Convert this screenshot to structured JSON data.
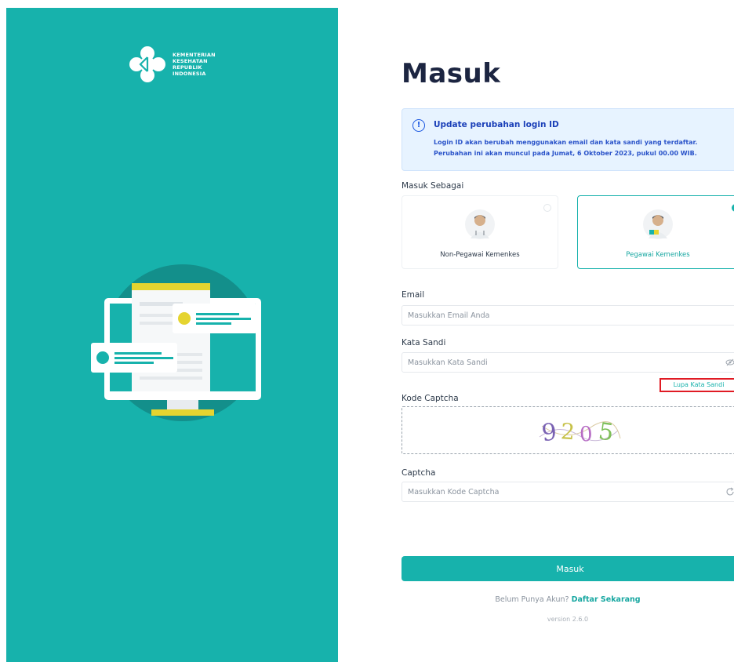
{
  "brand": {
    "logo_lines": [
      "KEMENTERIAN",
      "KESEHATAN",
      "REPUBLIK",
      "INDONESIA"
    ]
  },
  "page": {
    "title": "Masuk"
  },
  "notice": {
    "title": "Update perubahan login ID",
    "line1": "Login ID akan berubah menggunakan email dan kata sandi yang terdaftar.",
    "line2": "Perubahan ini akan muncul pada Jumat, 6 Oktober 2023, pukul 00.00 WIB."
  },
  "role": {
    "label": "Masuk Sebagai",
    "options": [
      {
        "label": "Non-Pegawai Kemenkes",
        "selected": false
      },
      {
        "label": "Pegawai Kemenkes",
        "selected": true
      }
    ]
  },
  "email": {
    "label": "Email",
    "placeholder": "Masukkan Email Anda",
    "value": ""
  },
  "password": {
    "label": "Kata Sandi",
    "placeholder": "Masukkan Kata Sandi",
    "value": "",
    "toggle_icon": "eye-off-icon"
  },
  "forgot_password": "Lupa Kata Sandi",
  "captcha_image": {
    "label": "Kode Captcha",
    "text": "9205"
  },
  "captcha": {
    "label": "Captcha",
    "placeholder": "Masukkan Kode Captcha",
    "value": "",
    "refresh_icon": "refresh-icon"
  },
  "submit_label": "Masuk",
  "register": {
    "prompt": "Belum Punya Akun?",
    "link": "Daftar Sekarang"
  },
  "version": "version 2.6.0",
  "colors": {
    "primary": "#17b2ac",
    "notice_bg": "#e7f3ff",
    "notice_text": "#1a3fb8",
    "highlight_border": "#e01b24"
  }
}
